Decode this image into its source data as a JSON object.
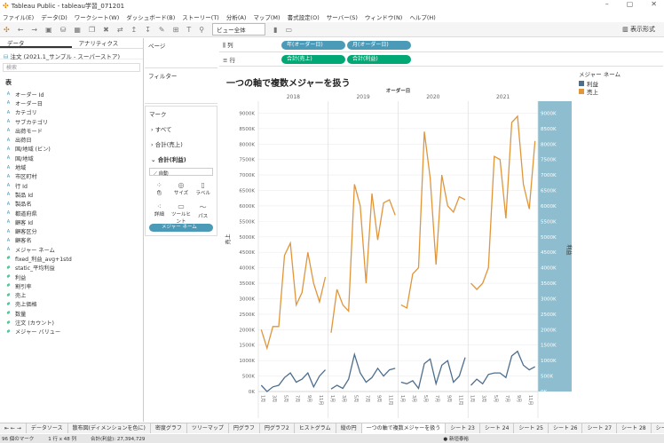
{
  "window": {
    "title": "Tableau Public - tableau学習_071201"
  },
  "menu": [
    "ファイル(E)",
    "データ(D)",
    "ワークシート(W)",
    "ダッシュボード(B)",
    "ストーリー(T)",
    "分析(A)",
    "マップ(M)",
    "書式設定(O)",
    "サーバー(S)",
    "ウィンドウ(N)",
    "ヘルプ(H)"
  ],
  "toolbar": {
    "fit": "ビュー全体",
    "show_me": "表示形式"
  },
  "data_pane": {
    "tab_data": "データ",
    "tab_analytics": "アナリティクス",
    "source": "注文 (2021.1_サンプル - スーパーストア)",
    "search_placeholder": "検索",
    "table_label": "表",
    "fields": [
      {
        "name": "オーダー Id",
        "type": "dim"
      },
      {
        "name": "オーダー日",
        "type": "dim"
      },
      {
        "name": "カテゴリ",
        "type": "dim"
      },
      {
        "name": "サブカテゴリ",
        "type": "dim"
      },
      {
        "name": "出荷モード",
        "type": "dim"
      },
      {
        "name": "出荷日",
        "type": "dim"
      },
      {
        "name": "国/地域 (ビン)",
        "type": "dim"
      },
      {
        "name": "国/地域",
        "type": "dim"
      },
      {
        "name": "地域",
        "type": "dim"
      },
      {
        "name": "市区町村",
        "type": "dim"
      },
      {
        "name": "行 Id",
        "type": "dim"
      },
      {
        "name": "製品 Id",
        "type": "dim"
      },
      {
        "name": "製品名",
        "type": "dim"
      },
      {
        "name": "都道府県",
        "type": "dim"
      },
      {
        "name": "顧客 Id",
        "type": "dim"
      },
      {
        "name": "顧客区分",
        "type": "dim"
      },
      {
        "name": "顧客名",
        "type": "dim"
      },
      {
        "name": "メジャー ネーム",
        "type": "dim"
      },
      {
        "name": "fixed_利益_avg+1std",
        "type": "meas"
      },
      {
        "name": "static_平均利益",
        "type": "meas"
      },
      {
        "name": "利益",
        "type": "meas"
      },
      {
        "name": "割引率",
        "type": "meas"
      },
      {
        "name": "売上",
        "type": "meas"
      },
      {
        "name": "売上価格",
        "type": "meas"
      },
      {
        "name": "数量",
        "type": "meas"
      },
      {
        "name": "注文 (カウント)",
        "type": "meas"
      },
      {
        "name": "メジャー バリュー",
        "type": "meas"
      }
    ]
  },
  "cards": {
    "pages": "ページ",
    "filters": "フィルター",
    "marks": "マーク",
    "marks_all": "すべて",
    "marks_sales": "合計(売上)",
    "marks_profit": "合計(利益)",
    "mark_type": "自動",
    "buttons": [
      "色",
      "サイズ",
      "ラベル",
      "詳細",
      "ツールヒント",
      "パス"
    ],
    "color_pill": "メジャー ネーム"
  },
  "shelves": {
    "columns_label": "列",
    "rows_label": "行",
    "columns": [
      "年(オーダー日)",
      "月(オーダー日)"
    ],
    "rows": [
      "合計(売上)",
      "合計(利益)"
    ]
  },
  "view": {
    "title": "一つの軸で複数メジャーを扱う",
    "header": "オーダー日"
  },
  "legend": {
    "title": "メジャー ネーム",
    "items": [
      {
        "name": "利益",
        "color": "#4e6e8e"
      },
      {
        "name": "売上",
        "color": "#e0963b"
      }
    ]
  },
  "chart_data": {
    "type": "line",
    "years": [
      "2018",
      "2019",
      "2020",
      "2021"
    ],
    "months": [
      "1月",
      "2月",
      "3月",
      "4月",
      "5月",
      "6月",
      "7月",
      "8月",
      "9月",
      "10月",
      "11月",
      "12月"
    ],
    "ylabel": "売上",
    "ylabel_right": "利益",
    "ylim": [
      0,
      9500
    ],
    "yticks": [
      "0K",
      "500K",
      "1000K",
      "1500K",
      "2000K",
      "2500K",
      "3000K",
      "3500K",
      "4000K",
      "4500K",
      "5000K",
      "5500K",
      "6000K",
      "6500K",
      "7000K",
      "7500K",
      "8000K",
      "8500K",
      "9000K"
    ],
    "series": [
      {
        "name": "売上",
        "color": "#e0963b",
        "values": [
          2000,
          1400,
          2100,
          2100,
          4400,
          4800,
          2800,
          3200,
          4500,
          3500,
          2900,
          3700,
          1900,
          3300,
          2800,
          2600,
          6700,
          6000,
          3500,
          6400,
          4900,
          6100,
          6200,
          5700,
          2800,
          2700,
          3800,
          4000,
          8400,
          6900,
          4100,
          7000,
          6000,
          5800,
          6300,
          6200,
          3500,
          3300,
          3500,
          4000,
          7600,
          7500,
          5600,
          8700,
          8900,
          6700,
          5900,
          8100
        ]
      },
      {
        "name": "利益",
        "color": "#4e6e8e",
        "values": [
          200,
          0,
          150,
          200,
          450,
          600,
          300,
          400,
          600,
          150,
          500,
          700,
          80,
          200,
          100,
          400,
          1200,
          600,
          300,
          450,
          750,
          500,
          700,
          750,
          300,
          250,
          350,
          100,
          900,
          1050,
          250,
          850,
          1000,
          300,
          500,
          1100,
          200,
          400,
          250,
          550,
          600,
          600,
          450,
          1150,
          1300,
          850,
          700,
          800
        ]
      }
    ]
  },
  "sheet_tabs": [
    "データソース",
    "散布図(ディメンションを色に)",
    "密度グラフ",
    "ツリーマップ",
    "円グラフ",
    "円グラフ2",
    "ヒストグラム",
    "縦の円",
    "一つの軸で複数メジャーを扱う",
    "シート 23",
    "シート 24",
    "シート 25",
    "シート 26",
    "シート 27",
    "シート 28",
    "シート 29",
    "バレート図1",
    "バレー"
  ],
  "status": {
    "marks": "96 個のマーク",
    "rows_cols": "1 行 x 48 列",
    "sum": "合計(利益): 27,394,729",
    "user": "新垣泰裕"
  }
}
